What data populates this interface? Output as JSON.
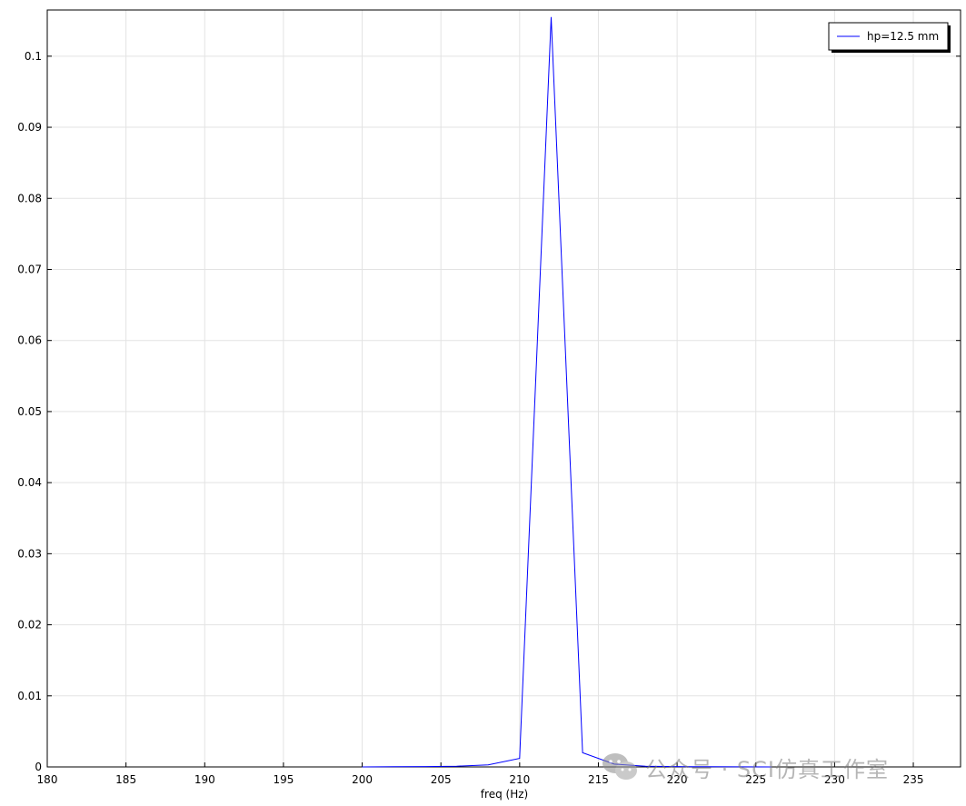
{
  "chart_data": {
    "type": "line",
    "title": "",
    "xlabel": "freq (Hz)",
    "ylabel": "",
    "xlim": [
      180,
      238
    ],
    "ylim": [
      0,
      0.1065
    ],
    "grid": true,
    "legend_position": "top-right",
    "x_ticks": [
      "180",
      "185",
      "190",
      "195",
      "200",
      "205",
      "210",
      "215",
      "220",
      "225",
      "230",
      "235"
    ],
    "y_ticks": [
      "0",
      "0.01",
      "0.02",
      "0.03",
      "0.04",
      "0.05",
      "0.06",
      "0.07",
      "0.08",
      "0.09",
      "0.1"
    ],
    "series": [
      {
        "name": "hp=12.5 mm",
        "color": "#0000ff",
        "x": [
          200,
          202,
          204,
          206,
          208,
          210,
          212,
          214,
          216,
          218,
          220,
          222,
          224,
          226
        ],
        "y": [
          0.0,
          2e-05,
          5e-05,
          0.0001,
          0.0003,
          0.0012,
          0.1055,
          0.002,
          0.0004,
          0.0001,
          5e-05,
          2e-05,
          1e-05,
          0.0
        ]
      }
    ]
  },
  "watermark": {
    "text": "公众号 · SCI仿真工作室",
    "icon": "wechat-icon"
  }
}
